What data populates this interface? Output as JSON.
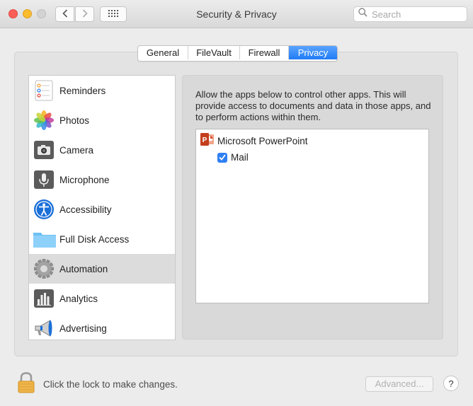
{
  "window": {
    "title": "Security & Privacy"
  },
  "toolbar": {
    "search_placeholder": "Search"
  },
  "tabs": [
    {
      "label": "General",
      "active": false
    },
    {
      "label": "FileVault",
      "active": false
    },
    {
      "label": "Firewall",
      "active": false
    },
    {
      "label": "Privacy",
      "active": true
    }
  ],
  "sidebar": {
    "items": [
      {
        "label": "Reminders",
        "icon": "reminders-icon"
      },
      {
        "label": "Photos",
        "icon": "photos-icon"
      },
      {
        "label": "Camera",
        "icon": "camera-icon"
      },
      {
        "label": "Microphone",
        "icon": "microphone-icon"
      },
      {
        "label": "Accessibility",
        "icon": "accessibility-icon"
      },
      {
        "label": "Full Disk Access",
        "icon": "folder-icon"
      },
      {
        "label": "Automation",
        "icon": "gear-icon",
        "selected": true
      },
      {
        "label": "Analytics",
        "icon": "analytics-icon"
      },
      {
        "label": "Advertising",
        "icon": "megaphone-icon"
      }
    ]
  },
  "main": {
    "description": "Allow the apps below to control other apps. This will provide access to documents and data in those apps, and to perform actions within them.",
    "apps": [
      {
        "name": "Microsoft PowerPoint",
        "icon": "powerpoint-icon",
        "targets": [
          {
            "name": "Mail",
            "checked": true
          }
        ]
      }
    ]
  },
  "footer": {
    "lock_text": "Click the lock to make changes.",
    "advanced_label": "Advanced...",
    "help_label": "?"
  },
  "colors": {
    "accent": "#1f7cf5",
    "selection": "#dcdcdc"
  }
}
